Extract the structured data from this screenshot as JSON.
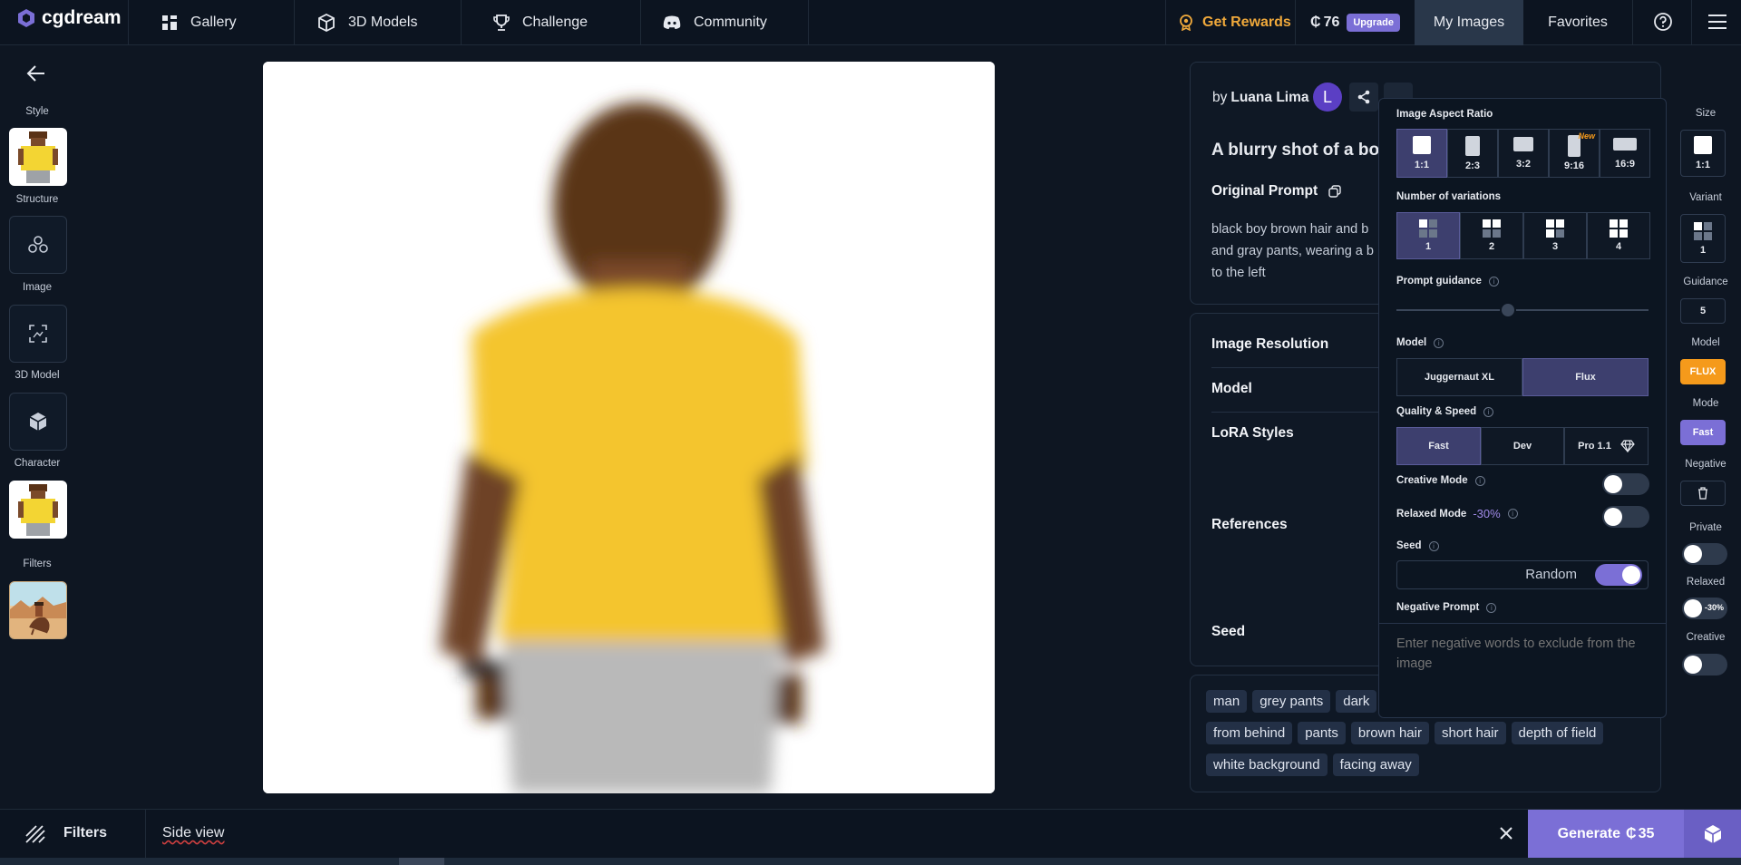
{
  "nav": {
    "brand": "cgdream",
    "gallery": "Gallery",
    "models": "3D Models",
    "challenge": "Challenge",
    "community": "Community",
    "rewards": "Get Rewards",
    "credits": "76",
    "upgrade": "Upgrade",
    "my_images": "My Images",
    "favorites": "Favorites"
  },
  "sidebar": {
    "style": "Style",
    "structure": "Structure",
    "image": "Image",
    "model3d": "3D Model",
    "character": "Character",
    "filters": "Filters"
  },
  "details": {
    "by": "by",
    "author": "Luana Lima",
    "avatar_letter": "L",
    "title": "A blurry shot of a boy",
    "original_prompt": "Original Prompt",
    "prompt_text": "black boy brown hair and b and gray pants, wearing a b to the left",
    "prompt_line1": "black boy brown hair and b",
    "prompt_line2": "and gray pants, wearing a b",
    "prompt_line3": "to the left",
    "image_resolution": "Image Resolution",
    "model": "Model",
    "lora_styles": "LoRA Styles",
    "references": "References",
    "seed": "Seed"
  },
  "tags": [
    "man",
    "grey pants",
    "dark",
    "from behind",
    "pants",
    "brown hair",
    "short hair",
    "depth of field",
    "white background",
    "facing away"
  ],
  "settings": {
    "aspect_ratio_label": "Image Aspect Ratio",
    "aspect_ratios": [
      "1:1",
      "2:3",
      "3:2",
      "9:16",
      "16:9"
    ],
    "new_badge": "New",
    "variations_label": "Number of variations",
    "variations": [
      "1",
      "2",
      "3",
      "4"
    ],
    "guidance_label": "Prompt guidance",
    "guidance_value": 5,
    "model_label": "Model",
    "models": [
      "Juggernaut XL",
      "Flux"
    ],
    "quality_label": "Quality & Speed",
    "qualities": [
      "Fast",
      "Dev",
      "Pro 1.1"
    ],
    "creative_mode": "Creative Mode",
    "relaxed_mode": "Relaxed Mode",
    "relaxed_discount": "-30%",
    "seed_label": "Seed",
    "seed_random": "Random",
    "negative_label": "Negative Prompt",
    "negative_placeholder": "Enter negative words to exclude from the image"
  },
  "right_col": {
    "size": "Size",
    "size_value": "1:1",
    "variant": "Variant",
    "variant_value": "1",
    "guidance": "Guidance",
    "guidance_value": "5",
    "model": "Model",
    "model_value": "FLUX",
    "mode": "Mode",
    "mode_value": "Fast",
    "negative": "Negative",
    "private": "Private",
    "relaxed": "Relaxed",
    "relaxed_value": "-30%",
    "creative": "Creative"
  },
  "bottom": {
    "filters": "Filters",
    "prompt": "Side view",
    "generate": "Generate",
    "generate_cost": "35"
  },
  "colors": {
    "accent": "#7b6fd6",
    "rewards": "#f0a93b",
    "flux": "#f59a1b",
    "background": "#0e1622"
  }
}
